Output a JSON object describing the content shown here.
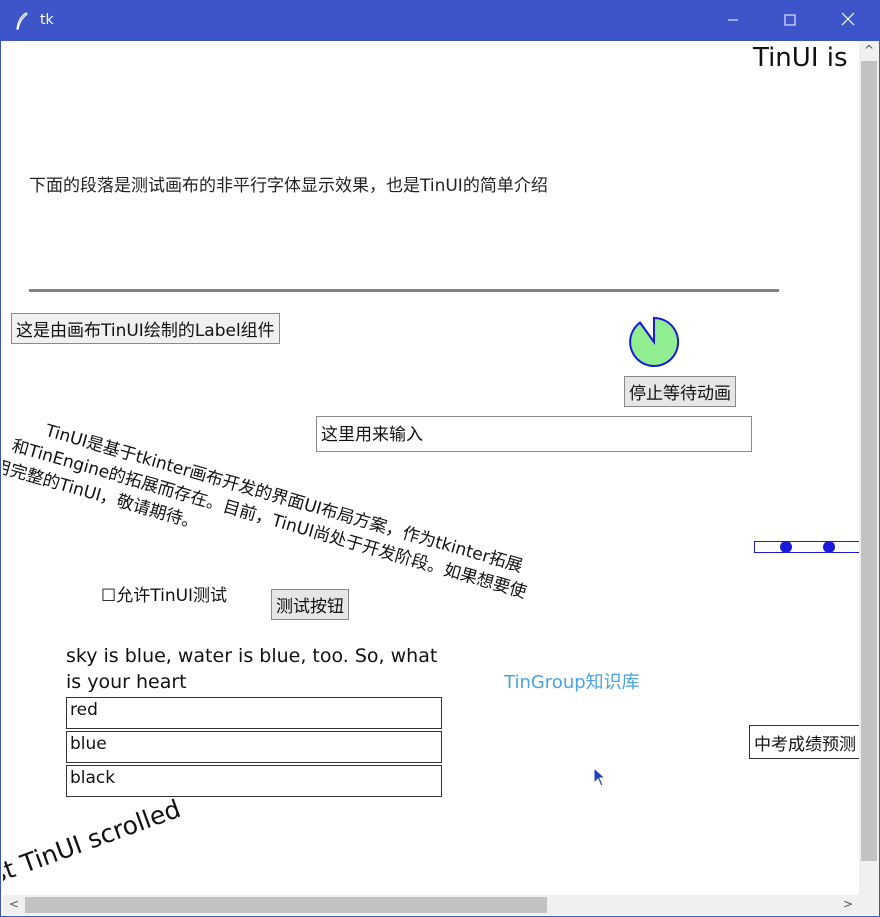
{
  "window": {
    "title": "tk",
    "accent": "#3d55c9"
  },
  "controls": {
    "minimize": "—",
    "maximize": "☐",
    "close": "✕"
  },
  "canvas": {
    "heading_partial": "TinUI is",
    "intro_text": "下面的段落是测试画布的非平行字体显示效果，也是TinUI的简单介绍",
    "label_widget": "这是由画布TinUI绘制的Label组件",
    "stop_button": "停止等待动画",
    "entry_value": "这里用来输入",
    "rotated_paragraph": {
      "line1": "TinUI是基于tkinter画布开发的界面UI布局方案，作为tkinter拓展",
      "line2": "和TinEngine的拓展而存在。目前，TinUI尚处于开发阶段。如果想要使",
      "line3": "用完整的TinUI，敬请期待。"
    },
    "checkbox_label": "☐允许TinUI测试",
    "test_button": "测试按钮",
    "question": {
      "line1": "sky is blue, water is blue, too. So, what",
      "line2": "is your heart"
    },
    "options": [
      "red",
      "blue",
      "black"
    ],
    "link_text": "TinGroup知识库",
    "combobox_partial": "中考成绩预测",
    "scrolled_text": "Test TinUI scrolled",
    "wait_icon_fill": "#90ee90",
    "wait_icon_stroke": "#1a1adb",
    "link_color": "#4aa3df"
  },
  "scrollbars": {
    "up": "^",
    "left": "<",
    "right": ">"
  }
}
